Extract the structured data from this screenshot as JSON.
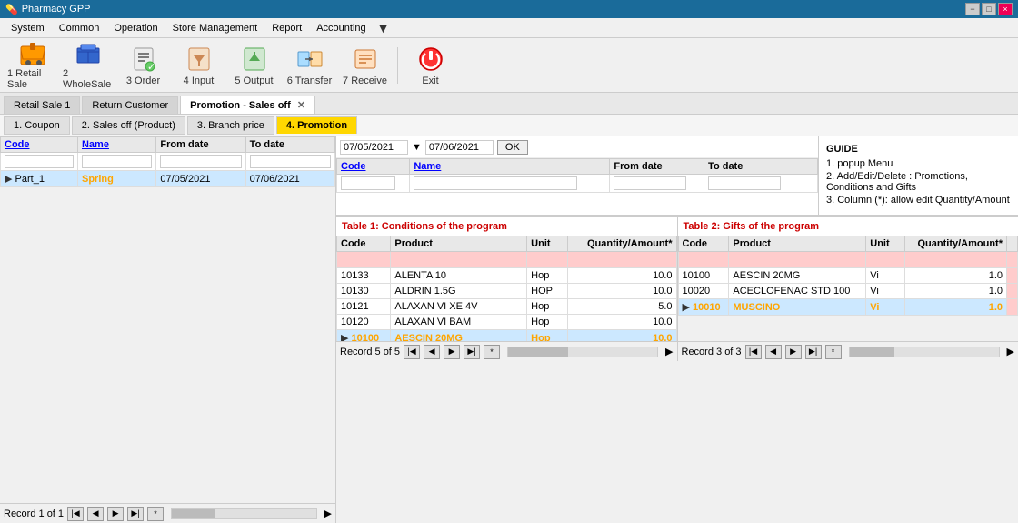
{
  "window": {
    "title": "Pharmacy GPP",
    "icon": "💊"
  },
  "title_bar": {
    "title": "Pharmacy GPP",
    "minimize": "−",
    "restore": "□",
    "close": "×"
  },
  "menu": {
    "items": [
      "System",
      "Common",
      "Operation",
      "Store Management",
      "Report",
      "Accounting"
    ]
  },
  "toolbar": {
    "buttons": [
      {
        "label": "1 Retail Sale",
        "icon": "🛒"
      },
      {
        "label": "2 WholeSale",
        "icon": "📦"
      },
      {
        "label": "3 Order",
        "icon": "📞"
      },
      {
        "label": "4 Input",
        "icon": "📥"
      },
      {
        "label": "5 Output",
        "icon": "📤"
      },
      {
        "label": "6 Transfer",
        "icon": "🔄"
      },
      {
        "label": "7 Receive",
        "icon": "📋"
      },
      {
        "label": "Exit",
        "icon": "🚪"
      }
    ]
  },
  "tabs": [
    {
      "label": "Retail Sale 1",
      "active": false,
      "closable": false
    },
    {
      "label": "Return Customer",
      "active": false,
      "closable": false
    },
    {
      "label": "Promotion - Sales off",
      "active": true,
      "closable": true
    }
  ],
  "sub_tabs": [
    {
      "label": "1. Coupon",
      "active": false
    },
    {
      "label": "2. Sales off (Product)",
      "active": false
    },
    {
      "label": "3. Branch price",
      "active": false
    },
    {
      "label": "4. Promotion",
      "active": true
    }
  ],
  "promo_table": {
    "columns": [
      "Code",
      "Name",
      "From date",
      "To date"
    ],
    "filter_row": [
      "",
      "",
      "",
      ""
    ],
    "rows": [
      {
        "code": "Part_1",
        "name": "Spring",
        "from_date": "07/05/2021",
        "to_date": "07/06/2021",
        "selected": true
      }
    ],
    "record_info": "Record 1 of 1"
  },
  "detail_table": {
    "columns": [
      "Code",
      "Name",
      "From date",
      "To date"
    ],
    "date_from": "07/05/2021",
    "date_to": "07/06/2021",
    "ok_label": "OK",
    "filter_row": [
      "",
      "",
      "",
      ""
    ]
  },
  "guide": {
    "title": "GUIDE",
    "lines": [
      "1. popup Menu",
      "2. Add/Edit/Delete : Promotions, Conditions and Gifts",
      "3. Column (*): allow edit Quantity/Amount"
    ]
  },
  "table1": {
    "title": "Table 1: Conditions of the program",
    "columns": [
      "Code",
      "Product",
      "Unit",
      "Quantity/Amount*"
    ],
    "rows": [
      {
        "code": "10133",
        "product": "ALENTA 10",
        "unit": "Hop",
        "qty": "10.0",
        "bg": ""
      },
      {
        "code": "10130",
        "product": "ALDRIN 1.5G",
        "unit": "HOP",
        "qty": "10.0",
        "bg": ""
      },
      {
        "code": "10121",
        "product": "ALAXAN VI XE 4V",
        "unit": "Hop",
        "qty": "5.0",
        "bg": ""
      },
      {
        "code": "10120",
        "product": "ALAXAN VI BAM",
        "unit": "Hop",
        "qty": "10.0",
        "bg": ""
      },
      {
        "code": "10100",
        "product": "AESCIN 20MG",
        "unit": "Hop",
        "qty": "10.0",
        "highlight": true
      }
    ],
    "record_info": "Record 5 of 5"
  },
  "table2": {
    "title": "Table 2: Gifts of the program",
    "columns": [
      "Code",
      "Product",
      "Unit",
      "Quantity/Amount*"
    ],
    "rows": [
      {
        "code": "10100",
        "product": "AESCIN 20MG",
        "unit": "Vi",
        "qty": "1.0",
        "bg": ""
      },
      {
        "code": "10020",
        "product": "ACECLOFENAC STD 100",
        "unit": "Vi",
        "qty": "1.0",
        "bg": ""
      },
      {
        "code": "10010",
        "product": "MUSCINO",
        "unit": "Vi",
        "qty": "1.0",
        "highlight": true,
        "text_orange": true
      }
    ],
    "record_info": "Record 3 of 3"
  }
}
